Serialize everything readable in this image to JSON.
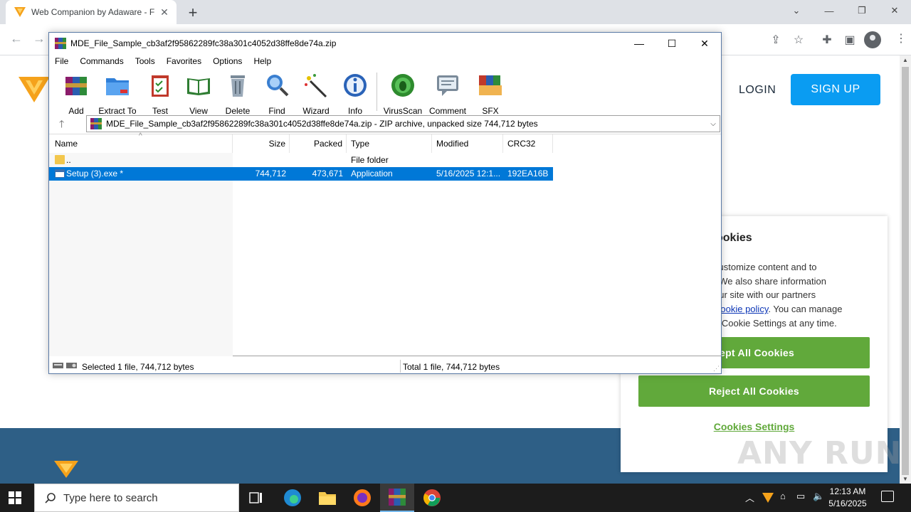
{
  "browser": {
    "tab_title": "Web Companion by Adaware - F",
    "tab_close": "✕",
    "new_tab": "+",
    "window_controls": [
      "⌄",
      "—",
      "❐",
      "✕"
    ]
  },
  "web_page": {
    "login": "LOGIN",
    "signup": "SIGN UP",
    "cookie": {
      "title": "ookies",
      "text_lines": [
        "customize content and to",
        ". We also share information",
        "our site with our partners"
      ],
      "policy_link": "Cookie policy",
      "policy_after": ". You can manage",
      "last_line": "n Cookie Settings at any time.",
      "accept": "cept All Cookies",
      "reject": "Reject All Cookies",
      "settings": "Cookies Settings"
    },
    "watermark": "ANY RUN"
  },
  "winrar": {
    "title": "MDE_File_Sample_cb3af2f95862289fc38a301c4052d38ffe8de74a.zip",
    "controls": [
      "—",
      "☐",
      "✕"
    ],
    "menu": [
      "File",
      "Commands",
      "Tools",
      "Favorites",
      "Options",
      "Help"
    ],
    "toolbar": [
      "Add",
      "Extract To",
      "Test",
      "View",
      "Delete",
      "Find",
      "Wizard",
      "Info",
      "VirusScan",
      "Comment",
      "SFX"
    ],
    "address": "MDE_File_Sample_cb3af2f95862289fc38a301c4052d38ffe8de74a.zip - ZIP archive, unpacked size 744,712 bytes",
    "columns": [
      "Name",
      "Size",
      "Packed",
      "Type",
      "Modified",
      "CRC32"
    ],
    "rows": [
      {
        "name": "..",
        "size": "",
        "packed": "",
        "type": "File folder",
        "modified": "",
        "crc": ""
      },
      {
        "name": "Setup (3).exe *",
        "size": "744,712",
        "packed": "473,671",
        "type": "Application",
        "modified": "5/16/2025 12:1...",
        "crc": "192EA16B"
      }
    ],
    "status_left": "Selected 1 file, 744,712 bytes",
    "status_right": "Total 1 file, 744,712 bytes"
  },
  "taskbar": {
    "search_placeholder": "Type here to search",
    "time": "12:13 AM",
    "date": "5/16/2025"
  },
  "colors": {
    "accent_blue": "#0a9cf2",
    "cookie_green": "#61a93b",
    "selection": "#0078d7",
    "footer_band": "#2e5f86"
  }
}
